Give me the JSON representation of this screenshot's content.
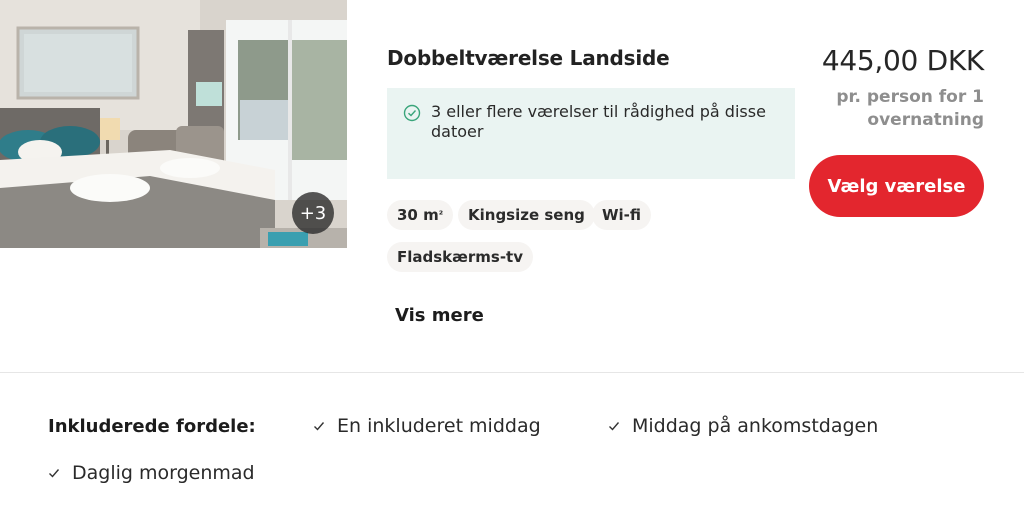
{
  "photo": {
    "alt": "Hotel room with bed",
    "extra_count": "+3"
  },
  "room": {
    "title": "Dobbeltværelse Landside",
    "availability": "3 eller flere værelser til rådighed på disse datoer"
  },
  "amenities": {
    "size_number": "30 m",
    "size_unit_sup": "²",
    "bed": "Kingsize seng",
    "wifi": "Wi-fi",
    "tv": "Fladskærms-tv"
  },
  "show_more_label": "Vis mere",
  "pricing": {
    "price": "445,00 DKK",
    "note": "pr. person for 1 overnatning",
    "select_label": "Vælg værelse"
  },
  "benefits": {
    "label": "Inkluderede fordele:",
    "items": [
      "En inkluderet middag",
      "Middag på ankomstdagen",
      "Daglig morgenmad"
    ]
  },
  "colors": {
    "accent": "#e3262e",
    "availability_bg": "#eaf4f2",
    "check": "#3aa57b"
  }
}
